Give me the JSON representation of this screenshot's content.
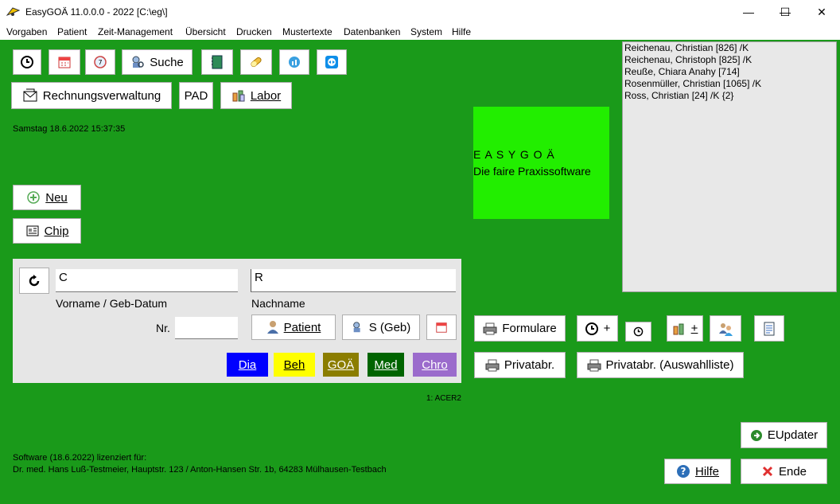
{
  "window": {
    "title": "EasyGOÄ 11.0.0.0 - 2022  [C:\\eg\\]",
    "minimize": "—",
    "maximize": "☐",
    "close": "✕"
  },
  "menu": [
    "Vorgaben",
    "Patient",
    "Zeit-Management",
    "Übersicht",
    "Drucken",
    "Mustertexte",
    "Datenbanken",
    "System",
    "Hilfe"
  ],
  "toolbar": {
    "search_label": "Suche",
    "billing_label": "Rechnungsverwaltung",
    "pad_label": "PAD",
    "labor_label": "Labor"
  },
  "datetime": "Samstag  18.6.2022  15:37:35",
  "actions": {
    "neu_label": "Neu",
    "chip_label": "Chip"
  },
  "brand": {
    "line1": "E A S Y G O Ä",
    "line2": "Die faire Praxissoftware"
  },
  "patients": [
    "Reichenau, Christian [826] /K",
    "Reichenau, Christoph [825] /K",
    "Reuße, Chiara Anahy [714]",
    "Rosenmüller, Christian [1065] /K",
    "Ross, Christian [24] /K {2}"
  ],
  "search_panel": {
    "firstname_value": "C",
    "lastname_value": "R",
    "firstname_label": "Vorname / Geb-Datum",
    "lastname_label": "Nachname",
    "nr_label": "Nr.",
    "nr_value": "",
    "patient_button": "Patient",
    "sgeb_button": "S (Geb)",
    "tags": [
      {
        "label": "Dia",
        "bg": "#0000ff",
        "fg": "#ffffff"
      },
      {
        "label": "Beh",
        "bg": "#ffff00",
        "fg": "#000000"
      },
      {
        "label": "GOÄ",
        "bg": "#8b7d00",
        "fg": "#ffffff"
      },
      {
        "label": "Med",
        "bg": "#006400",
        "fg": "#ffffff"
      },
      {
        "label": "Chro",
        "bg": "#9b6bcc",
        "fg": "#ffffff"
      }
    ]
  },
  "station": "1: ACER2",
  "right_buttons": {
    "formulare": "Formulare",
    "privatabr": "Privatabr.",
    "privatabr_list": "Privatabr. (Auswahlliste)",
    "clock_plus": "+",
    "labor_plus": "+"
  },
  "license": {
    "line1": "Software (18.6.2022) lizenziert für:",
    "line2": "Dr. med. Hans Luß-Testmeier, Hauptstr. 123 / Anton-Hansen Str. 1b, 64283 Mülhausen-Testbach"
  },
  "bottom": {
    "eupdater": "EUpdater",
    "hilfe": "Hilfe",
    "ende": "Ende"
  },
  "colors": {
    "background": "#1a9a1a",
    "brand_box": "#22ee00",
    "panel": "#e6e6e6"
  }
}
